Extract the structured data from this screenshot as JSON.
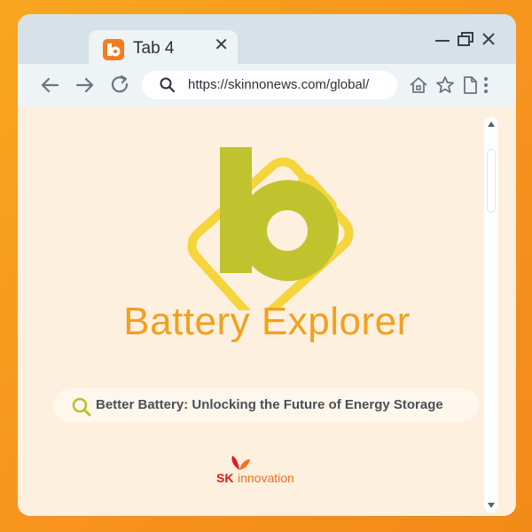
{
  "tab": {
    "title": "Tab 4",
    "favicon": "battery-explorer-favicon",
    "close_icon": "close-icon"
  },
  "window_controls": {
    "minimize": "minimize-icon",
    "restore": "restore-icon",
    "close": "close-icon"
  },
  "navigation": {
    "back": "back-arrow-icon",
    "forward": "forward-arrow-icon",
    "reload": "reload-icon"
  },
  "address_bar": {
    "url": "https://skinnonews.com/global/",
    "search_icon": "search-icon"
  },
  "toolbar": {
    "home": "home-icon",
    "bookmark": "star-icon",
    "page": "page-icon",
    "menu": "kebab-menu-icon"
  },
  "page": {
    "logo": "battery-explorer-logo",
    "title": "Battery Explorer",
    "search": {
      "icon": "search-icon",
      "text": "Better Battery: Unlocking the Future of Energy Storage"
    },
    "brand": {
      "sk": "SK",
      "rest": "innovation"
    }
  },
  "colors": {
    "background": "#f7931e",
    "browser_chrome": "#d7e1e8",
    "content_bg": "#fdf0df",
    "title": "#f0a11f",
    "logo_green": "#c0c32e",
    "logo_yellow": "#f6d43c",
    "brand_red": "#e2191b",
    "brand_orange": "#f37021"
  }
}
